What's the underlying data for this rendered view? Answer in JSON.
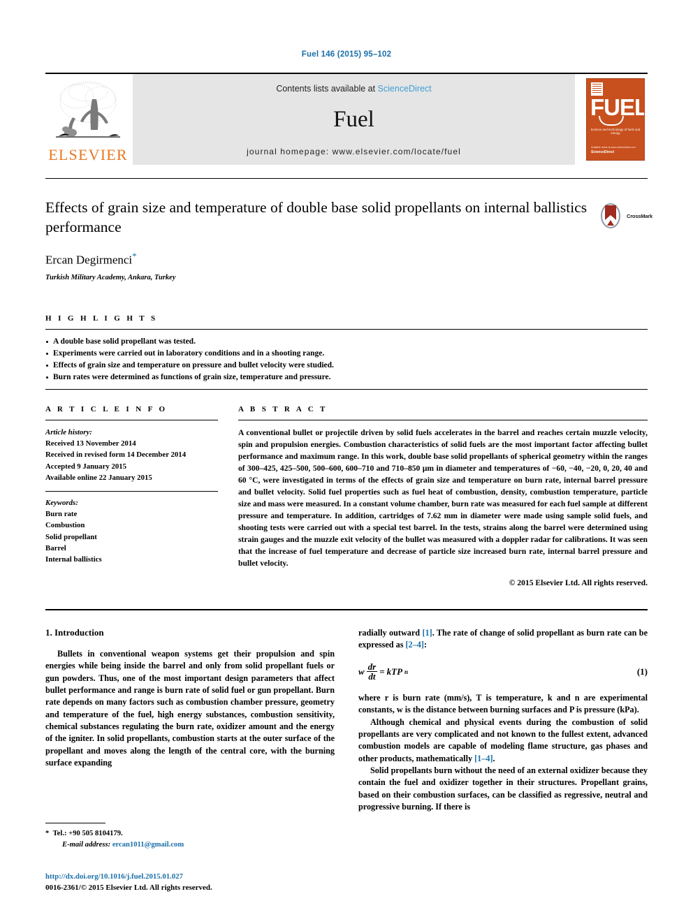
{
  "running_head": "Fuel 146 (2015) 95–102",
  "masthead": {
    "publisher": "ELSEVIER",
    "contents_prefix": "Contents lists available at ",
    "contents_link": "ScienceDirect",
    "journal_title": "Fuel",
    "homepage": "journal homepage: www.elsevier.com/locate/fuel",
    "cover": {
      "wordmark": "FUEL",
      "subtitle": "Science and technology of fuels and energy",
      "footer_line1": "Available online at www.sciencedirect.com",
      "footer_line2": "ScienceDirect"
    }
  },
  "article": {
    "title": "Effects of grain size and temperature of double base solid propellants on internal ballistics performance",
    "author": "Ercan Degirmenci",
    "author_marker": "*",
    "affiliation": "Turkish Military Academy, Ankara, Turkey",
    "crossmark_label": "CrossMark"
  },
  "highlights": {
    "heading": "H I G H L I G H T S",
    "items": [
      "A double base solid propellant was tested.",
      "Experiments were carried out in laboratory conditions and in a shooting range.",
      "Effects of grain size and temperature on pressure and bullet velocity were studied.",
      "Burn rates were determined as functions of grain size, temperature and pressure."
    ]
  },
  "article_info": {
    "heading": "A R T I C L E    I N F O",
    "history_label": "Article history:",
    "history": [
      "Received 13 November 2014",
      "Received in revised form 14 December 2014",
      "Accepted 9 January 2015",
      "Available online 22 January 2015"
    ],
    "keywords_label": "Keywords:",
    "keywords": [
      "Burn rate",
      "Combustion",
      "Solid propellant",
      "Barrel",
      "Internal ballistics"
    ]
  },
  "abstract": {
    "heading": "A B S T R A C T",
    "text": "A conventional bullet or projectile driven by solid fuels accelerates in the barrel and reaches certain muzzle velocity, spin and propulsion energies. Combustion characteristics of solid fuels are the most important factor affecting bullet performance and maximum range. In this work, double base solid propellants of spherical geometry within the ranges of 300–425, 425–500, 500–600, 600–710 and 710–850 µm in diameter and temperatures of −60, −40, −20, 0, 20, 40 and 60 °C, were investigated in terms of the effects of grain size and temperature on burn rate, internal barrel pressure and bullet velocity. Solid fuel properties such as fuel heat of combustion, density, combustion temperature, particle size and mass were measured. In a constant volume chamber, burn rate was measured for each fuel sample at different pressure and temperature. In addition, cartridges of 7.62 mm in diameter were made using sample solid fuels, and shooting tests were carried out with a special test barrel. In the tests, strains along the barrel were determined using strain gauges and the muzzle exit velocity of the bullet was measured with a doppler radar for calibrations. It was seen that the increase of fuel temperature and decrease of particle size increased burn rate, internal barrel pressure and bullet velocity.",
    "copyright": "© 2015 Elsevier Ltd. All rights reserved."
  },
  "body": {
    "section_heading": "1. Introduction",
    "left_paragraphs": [
      "Bullets in conventional weapon systems get their propulsion and spin energies while being inside the barrel and only from solid propellant fuels or gun powders. Thus, one of the most important design parameters that affect bullet performance and range is burn rate of solid fuel or gun propellant. Burn rate depends on many factors such as combustion chamber pressure, geometry and temperature of the fuel, high energy substances, combustion sensitivity, chemical substances regulating the burn rate, oxidizer amount and the energy of the igniter. In solid propellants, combustion starts at the outer surface of the propellant and moves along the length of the central core, with the burning surface expanding"
    ],
    "right_intro_pre": "radially outward ",
    "right_intro_ref1": "[1]",
    "right_intro_mid": ". The rate of change of solid propellant as burn rate can be expressed as ",
    "right_intro_ref2": "[2–4]",
    "right_intro_post": ":",
    "equation": {
      "w": "w",
      "num": "dr",
      "den": "dt",
      "equals": "=",
      "rhs_k": "kTP",
      "rhs_n": "n",
      "number": "(1)"
    },
    "right_paragraphs": [
      "where r is burn rate (mm/s), T is temperature, k and n are experimental constants, w is the distance between burning surfaces and P is pressure (kPa).",
      "Although chemical and physical events during the combustion of solid propellants are very complicated and not known to the fullest extent, advanced combustion models are capable of modeling flame structure, gas phases and other products, mathematically",
      "Solid propellants burn without the need of an external oxidizer because they contain the fuel and oxidizer together in their structures. Propellant grains, based on their combustion surfaces, can be classified as regressive, neutral and progressive burning. If there is"
    ],
    "right_ref3": "[1–4]",
    "right_ref3_tail": "."
  },
  "footnote": {
    "marker": "*",
    "tel": "Tel.: +90 505 8104179.",
    "email_label": "E-mail address:",
    "email": "ercan1011@gmail.com"
  },
  "colophon": {
    "doi": "http://dx.doi.org/10.1016/j.fuel.2015.01.027",
    "issn": "0016-2361/© 2015 Elsevier Ltd. All rights reserved."
  },
  "colors": {
    "link_blue": "#1a6fa8",
    "sciencedirect_blue": "#3f9fd4",
    "elsevier_orange": "#e87722",
    "cover_orange": "#c8501e",
    "masthead_grey": "#e5e5e5"
  }
}
